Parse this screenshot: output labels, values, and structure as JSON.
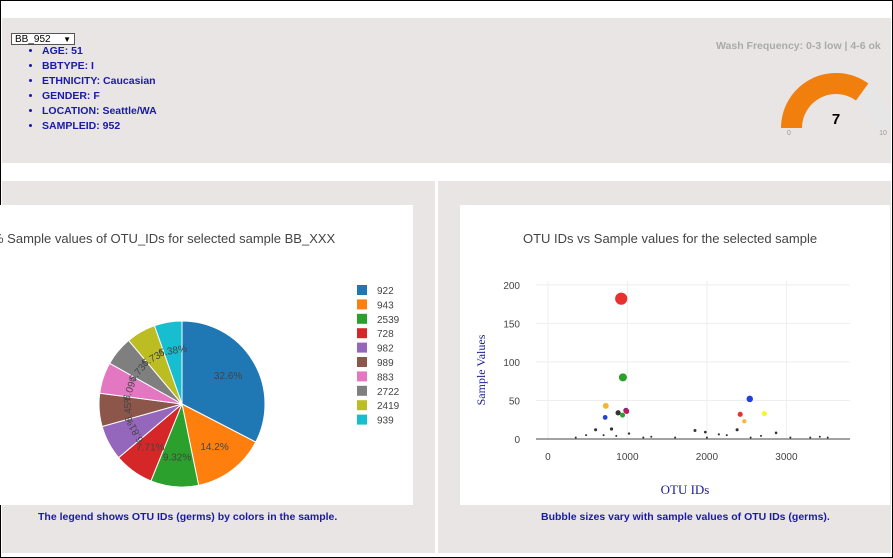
{
  "dropdown": {
    "selected": "BB_952",
    "arrow": "▼"
  },
  "metadata": [
    "AGE: 51",
    "BBTYPE: I",
    "ETHNICITY: Caucasian",
    "GENDER: F",
    "LOCATION: Seattle/WA",
    "SAMPLEID: 952"
  ],
  "gauge": {
    "title": "Wash Frequency: 0-3 low | 4-6 ok",
    "value": 7,
    "min_label": "0",
    "max_label": "10",
    "max": 10,
    "fill_color": "#f07f0e",
    "track_color": "#e6e6e6"
  },
  "captions": {
    "pie": "The legend shows OTU IDs (germs) by colors in the sample.",
    "bubble": "Bubble sizes vary with sample values of OTU IDs (germs)."
  },
  "chart_data": [
    {
      "type": "pie",
      "title": "% Sample values of OTU_IDs for selected sample BB_XXX",
      "labels": [
        "922",
        "943",
        "2539",
        "728",
        "982",
        "989",
        "883",
        "2722",
        "2419",
        "939"
      ],
      "values": [
        32.6,
        14.2,
        9.32,
        7.71,
        6.81,
        6.45,
        6.09,
        5.73,
        5.73,
        5.38
      ],
      "text": [
        "32.6%",
        "14.2%",
        "9.32%",
        "7.71%",
        "6.81%",
        "6.45%",
        "6.09%",
        "5.73%",
        "5.73%",
        "5.38%"
      ],
      "colors": [
        "#1f77b4",
        "#ff7f0e",
        "#2ca02c",
        "#d62728",
        "#9467bd",
        "#8c564b",
        "#e377c2",
        "#7f7f7f",
        "#bcbd22",
        "#17becf"
      ],
      "legend": "right"
    },
    {
      "type": "scatter",
      "title": "OTU IDs vs Sample values for the selected sample",
      "xlabel": "OTU IDs",
      "ylabel": "Sample Values",
      "xlim": [
        -150,
        3800
      ],
      "ylim": [
        0,
        205
      ],
      "xticks": [
        0,
        1000,
        2000,
        3000
      ],
      "yticks": [
        0,
        50,
        100,
        150,
        200
      ],
      "grid": true,
      "points": [
        {
          "x": 922,
          "y": 182,
          "c": "#e8302f"
        },
        {
          "x": 943,
          "y": 80,
          "c": "#2ca02c"
        },
        {
          "x": 2539,
          "y": 52,
          "c": "#2241d6"
        },
        {
          "x": 728,
          "y": 43,
          "c": "#f5b53b"
        },
        {
          "x": 982,
          "y": 37,
          "c": "#7a2a8c"
        },
        {
          "x": 989,
          "y": 36,
          "c": "#c2185b"
        },
        {
          "x": 883,
          "y": 34,
          "c": "#333333"
        },
        {
          "x": 2722,
          "y": 33,
          "c": "#f5f532"
        },
        {
          "x": 2419,
          "y": 32,
          "c": "#e8302f"
        },
        {
          "x": 939,
          "y": 31,
          "c": "#2ca02c"
        },
        {
          "x": 720,
          "y": 28,
          "c": "#2241d6"
        },
        {
          "x": 2470,
          "y": 23,
          "c": "#f5b53b"
        },
        {
          "x": 800,
          "y": 13,
          "c": "#333333"
        },
        {
          "x": 600,
          "y": 12,
          "c": "#333333"
        },
        {
          "x": 1850,
          "y": 11,
          "c": "#333333"
        },
        {
          "x": 1980,
          "y": 9,
          "c": "#333333"
        },
        {
          "x": 2870,
          "y": 8,
          "c": "#333333"
        },
        {
          "x": 2380,
          "y": 12,
          "c": "#333333"
        },
        {
          "x": 2150,
          "y": 6,
          "c": "#333333"
        },
        {
          "x": 2250,
          "y": 5,
          "c": "#333333"
        },
        {
          "x": 1020,
          "y": 7,
          "c": "#333333"
        },
        {
          "x": 700,
          "y": 5,
          "c": "#333333"
        },
        {
          "x": 860,
          "y": 4,
          "c": "#333333"
        },
        {
          "x": 480,
          "y": 5,
          "c": "#333333"
        },
        {
          "x": 1300,
          "y": 3,
          "c": "#333333"
        },
        {
          "x": 2680,
          "y": 4,
          "c": "#333333"
        },
        {
          "x": 3420,
          "y": 3,
          "c": "#333333"
        },
        {
          "x": 3520,
          "y": 2,
          "c": "#333333"
        },
        {
          "x": 3050,
          "y": 2,
          "c": "#333333"
        },
        {
          "x": 1600,
          "y": 2,
          "c": "#333333"
        },
        {
          "x": 350,
          "y": 2,
          "c": "#333333"
        },
        {
          "x": 1200,
          "y": 2,
          "c": "#333333"
        },
        {
          "x": 2000,
          "y": 2,
          "c": "#333333"
        },
        {
          "x": 2550,
          "y": 2,
          "c": "#333333"
        },
        {
          "x": 3300,
          "y": 2,
          "c": "#333333"
        }
      ]
    }
  ]
}
